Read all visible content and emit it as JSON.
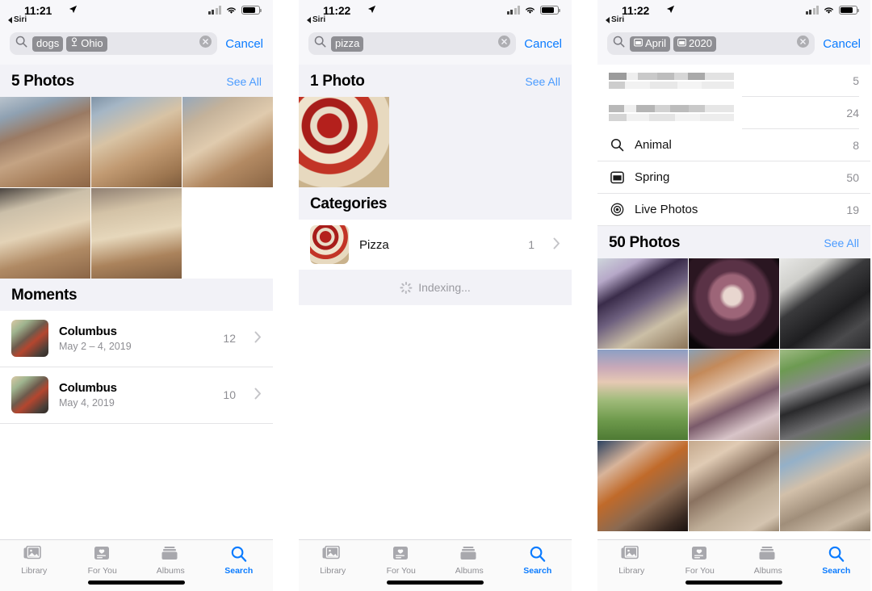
{
  "meta": {
    "accent_blue": "#0a7bff",
    "link_blue": "#4a9bff",
    "token_gray": "#8e8e93",
    "section_bg": "#f2f2f7"
  },
  "tabbar": {
    "items": [
      {
        "label": "Library",
        "icon": "library-icon",
        "active": false
      },
      {
        "label": "For You",
        "icon": "for-you-icon",
        "active": false
      },
      {
        "label": "Albums",
        "icon": "albums-icon",
        "active": false
      },
      {
        "label": "Search",
        "icon": "search-icon",
        "active": true
      }
    ]
  },
  "panels": [
    {
      "id": "panel-dogs-ohio",
      "status": {
        "time": "11:21",
        "siri_back": "Siri",
        "location_arrow": "location-arrow-icon"
      },
      "search": {
        "cancel": "Cancel",
        "clear": "clear-icon",
        "tokens": [
          {
            "text": "dogs",
            "icon": null
          },
          {
            "text": "Ohio",
            "icon": "location-pin-icon"
          }
        ]
      },
      "photos_section": {
        "title": "5 Photos",
        "see_all": "See All",
        "count": 5
      },
      "moments_section": {
        "title": "Moments",
        "rows": [
          {
            "title": "Columbus",
            "subtitle": "May 2 – 4, 2019",
            "count": "12",
            "chevron": "chevron-right-icon"
          },
          {
            "title": "Columbus",
            "subtitle": "May 4, 2019",
            "count": "10",
            "chevron": "chevron-right-icon"
          }
        ]
      }
    },
    {
      "id": "panel-pizza",
      "status": {
        "time": "11:22",
        "siri_back": "Siri",
        "location_arrow": "location-arrow-icon"
      },
      "search": {
        "cancel": "Cancel",
        "clear": "clear-icon",
        "tokens": [
          {
            "text": "pizza",
            "icon": null
          }
        ]
      },
      "photos_section": {
        "title": "1 Photo",
        "see_all": "See All",
        "count": 1
      },
      "categories_section": {
        "title": "Categories",
        "rows": [
          {
            "title": "Pizza",
            "count": "1",
            "chevron": "chevron-right-icon"
          }
        ]
      },
      "indexing": {
        "label": "Indexing...",
        "icon": "spinner-icon"
      }
    },
    {
      "id": "panel-april-2020",
      "status": {
        "time": "11:22",
        "siri_back": "Siri",
        "location_arrow": "location-arrow-icon"
      },
      "search": {
        "cancel": "Cancel",
        "clear": "clear-icon",
        "tokens": [
          {
            "text": "April",
            "icon": "calendar-icon"
          },
          {
            "text": "2020",
            "icon": "calendar-icon"
          }
        ]
      },
      "suggestion_rows": [
        {
          "label": "",
          "redacted": true,
          "count": "5",
          "icon": null
        },
        {
          "label": "",
          "redacted": true,
          "count": "24",
          "icon": null
        },
        {
          "label": "Animal",
          "redacted": false,
          "count": "8",
          "icon": "search-icon"
        },
        {
          "label": "Spring",
          "redacted": false,
          "count": "50",
          "icon": "calendar-icon"
        },
        {
          "label": "Live Photos",
          "redacted": false,
          "count": "19",
          "icon": "live-photo-icon"
        }
      ],
      "photos_section": {
        "title": "50 Photos",
        "see_all": "See All",
        "count": 9
      }
    }
  ]
}
